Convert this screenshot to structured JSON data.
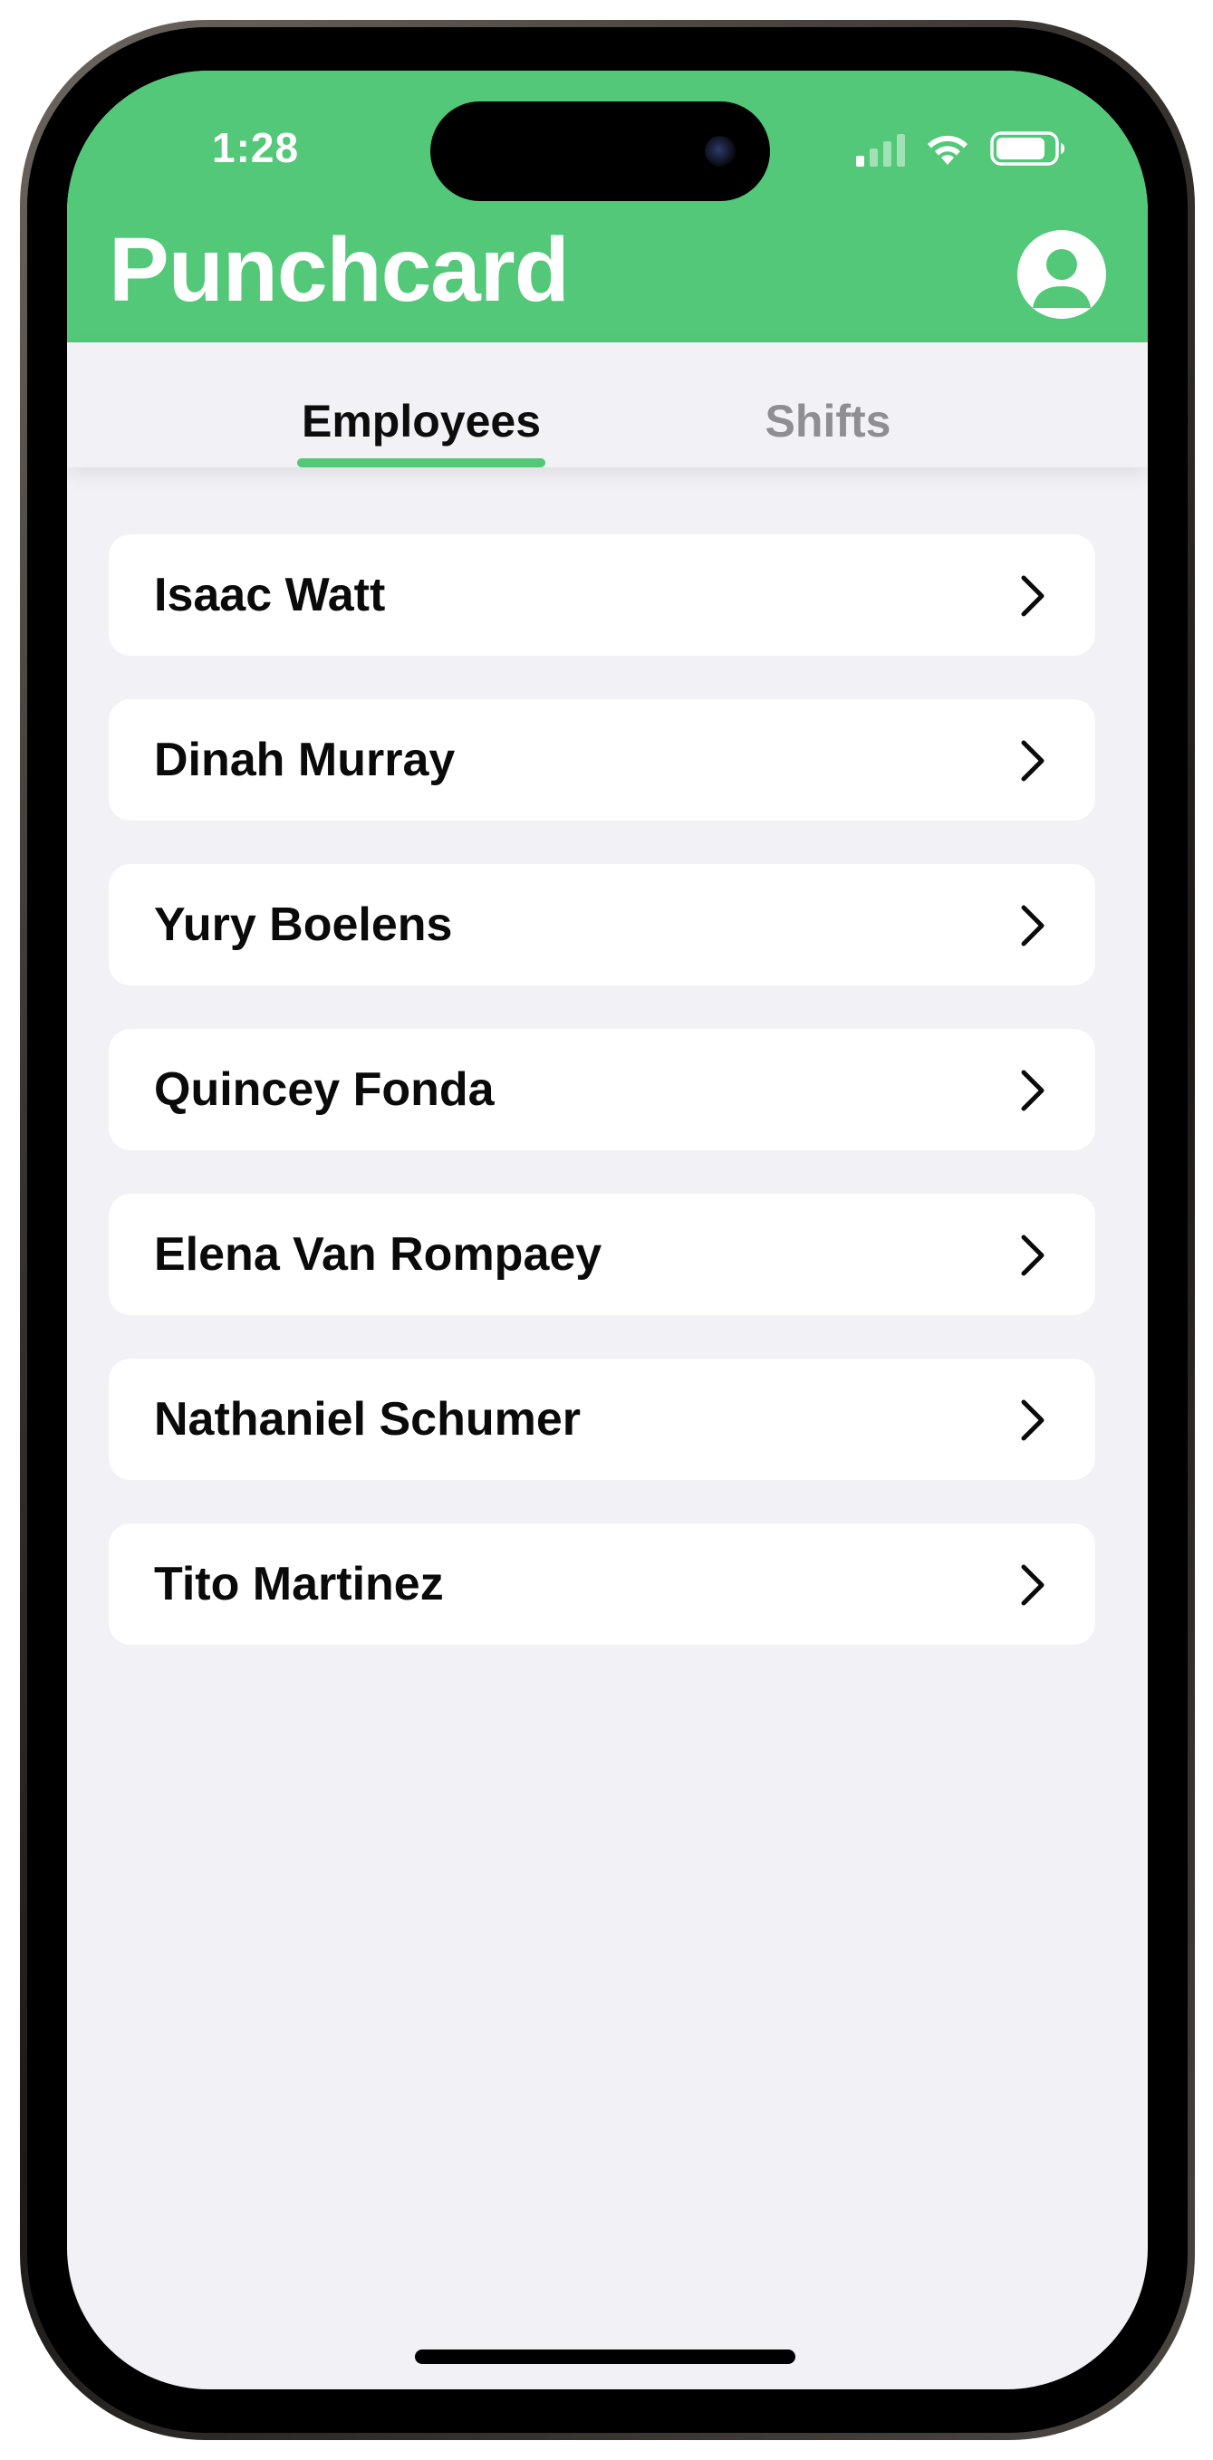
{
  "status_bar": {
    "time": "1:28",
    "signal_bars_active": 1,
    "signal_bars_total": 4,
    "battery_level": 0.85
  },
  "header": {
    "title": "Punchcard",
    "background_color": "#52c878",
    "profile_icon": "person-circle-icon"
  },
  "tabs": [
    {
      "label": "Employees",
      "selected": true
    },
    {
      "label": "Shifts",
      "selected": false
    }
  ],
  "employees": [
    {
      "name": "Isaac Watt"
    },
    {
      "name": "Dinah Murray"
    },
    {
      "name": "Yury Boelens"
    },
    {
      "name": "Quincey Fonda"
    },
    {
      "name": "Elena Van Rompaey"
    },
    {
      "name": "Nathaniel Schumer"
    },
    {
      "name": "Tito Martinez"
    }
  ],
  "colors": {
    "accent": "#52c878",
    "background": "#f1f1f6",
    "row_background": "#ffffff",
    "inactive_tab": "#8e8e93"
  }
}
